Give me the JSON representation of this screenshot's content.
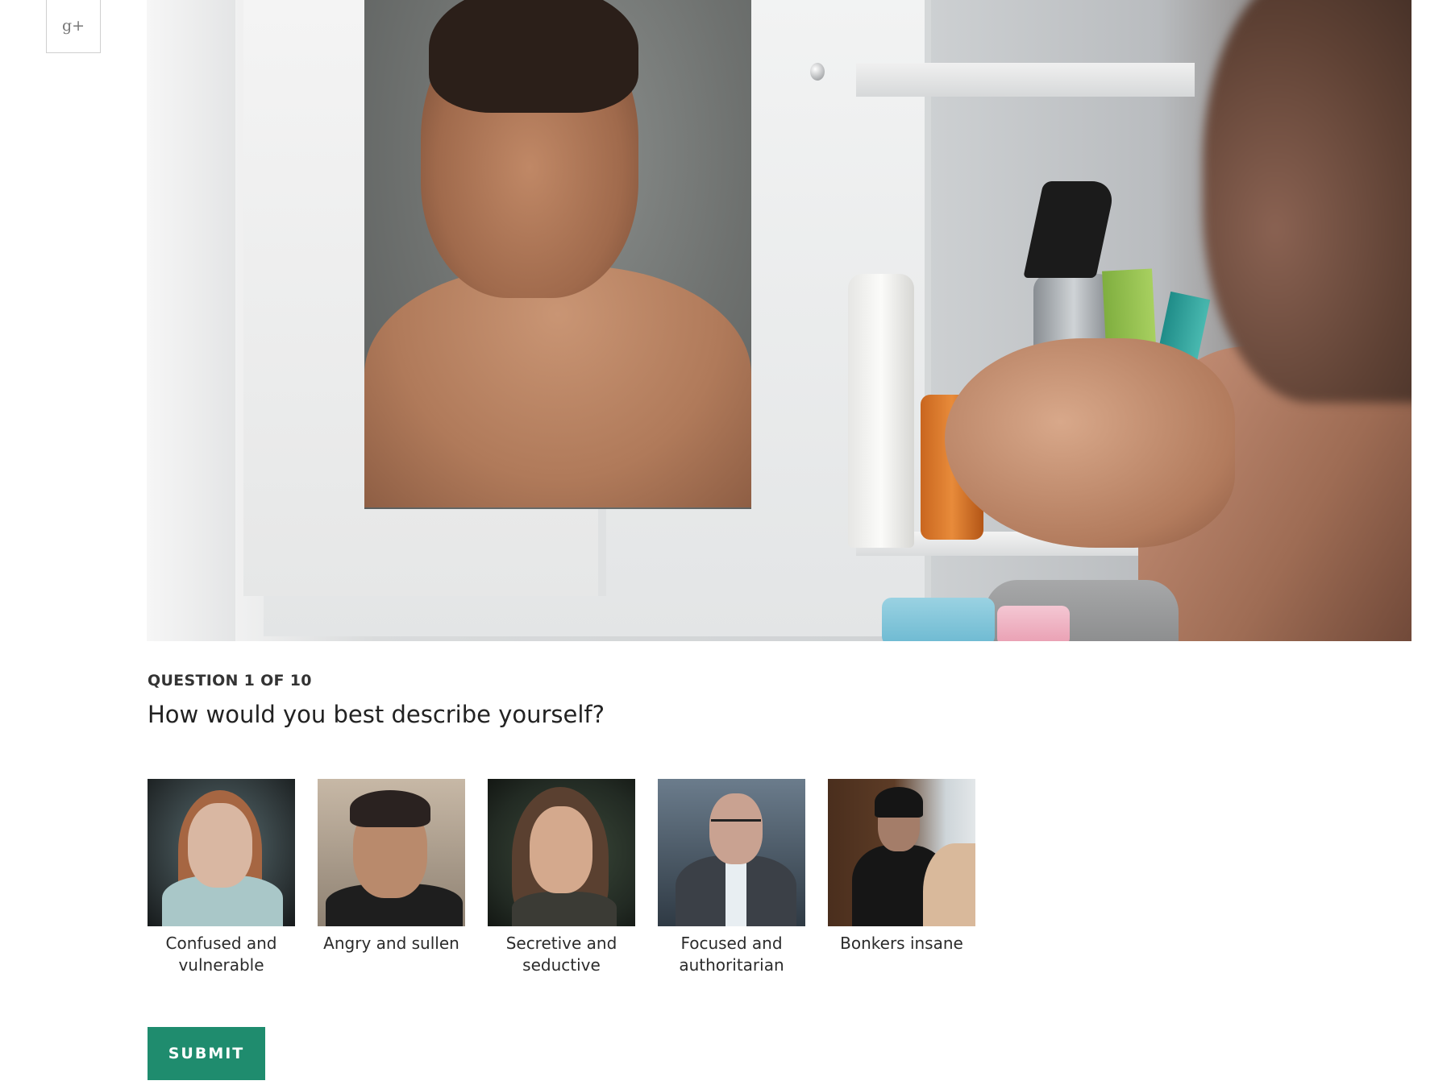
{
  "share": {
    "gplus_label": "g+"
  },
  "quiz": {
    "counter": "QUESTION 1 OF 10",
    "question": "How would you best describe yourself?",
    "options": [
      {
        "caption": "Confused and vulnerable"
      },
      {
        "caption": "Angry and sullen"
      },
      {
        "caption": "Secretive and seductive"
      },
      {
        "caption": "Focused and authoritarian"
      },
      {
        "caption": "Bonkers insane"
      }
    ],
    "submit_label": "SUBMIT"
  },
  "colors": {
    "accent": "#1f8c6e",
    "text": "#2b2b2b"
  }
}
